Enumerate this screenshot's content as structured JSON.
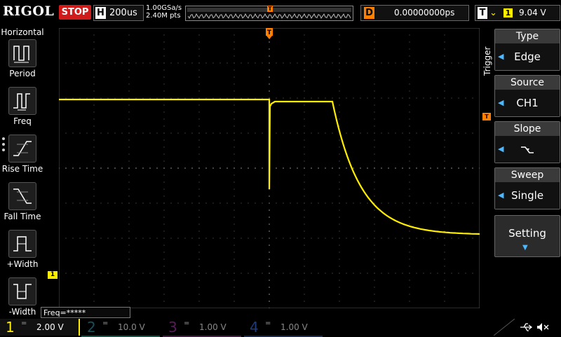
{
  "topbar": {
    "logo": "RIGOL",
    "run_status": "STOP",
    "timebase_key": "H",
    "timebase": "200us",
    "sample_rate": "1.00GSa/s",
    "memory_depth": "2.40M pts",
    "trigger_marker": "T",
    "delay_key": "D",
    "delay": "0.00000000ps",
    "trigger_key": "T",
    "trigger_source": "1",
    "trigger_level": "9.04 V"
  },
  "left_menu": {
    "title": "Horizontal",
    "items": [
      {
        "label": "Period",
        "icon": "period-icon"
      },
      {
        "label": "Freq",
        "icon": "freq-icon"
      },
      {
        "label": "Rise Time",
        "icon": "rise-time-icon"
      },
      {
        "label": "Fall Time",
        "icon": "fall-time-icon"
      },
      {
        "label": "+Width",
        "icon": "pos-width-icon"
      },
      {
        "label": "-Width",
        "icon": "neg-width-icon"
      }
    ]
  },
  "freq_readout": "Freq=*****",
  "right_menu": {
    "tab": "Trigger",
    "items": [
      {
        "title": "Type",
        "value": "Edge"
      },
      {
        "title": "Source",
        "value": "CH1"
      },
      {
        "title": "Slope",
        "value": "falling-edge-icon"
      },
      {
        "title": "Sweep",
        "value": "Single"
      }
    ],
    "setting": "Setting"
  },
  "markers": {
    "ch1_ground": "1",
    "trigger_top": "T",
    "trigger_level": "T"
  },
  "channels": [
    {
      "num": "1",
      "coupling": "=",
      "scale": "2.00 V",
      "color": "#ffee00",
      "active": true
    },
    {
      "num": "2",
      "coupling": "=",
      "scale": "10.0 V",
      "color": "#17505c",
      "active": false
    },
    {
      "num": "3",
      "coupling": "=",
      "scale": "1.00 V",
      "color": "#5a1b5a",
      "active": false
    },
    {
      "num": "4",
      "coupling": "=",
      "scale": "1.00 V",
      "color": "#1f3c7a",
      "active": false
    }
  ],
  "colors": {
    "trace": "#ffee00",
    "trigger": "#ff7f00",
    "grid": "#3a3a3a",
    "stop": "#d11a1a",
    "accent": "#4db8ff"
  }
}
